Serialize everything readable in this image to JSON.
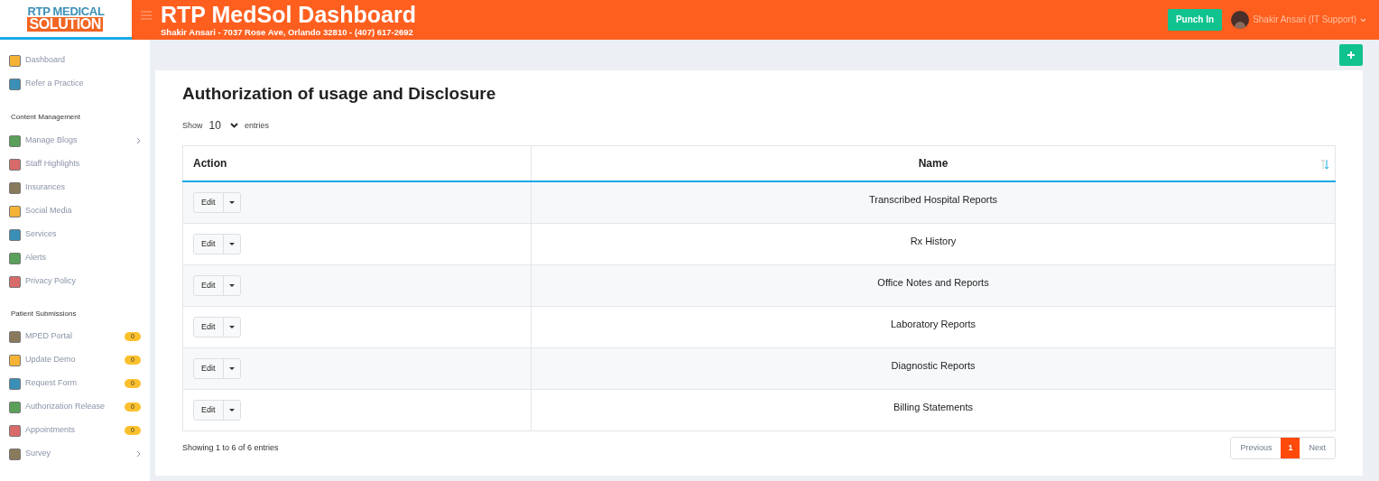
{
  "logo": {
    "line_1": "RTP MEDICAL",
    "line_2": "SOLUTION"
  },
  "header": {
    "title": "RTP MedSol Dashboard",
    "subtitle": "Shakir Ansari - 7037 Rose Ave, Orlando 32810 - (407) 617-2692",
    "punch_button": "Punch In",
    "user": "Shakir Ansari (IT Support)"
  },
  "sidebar": {
    "sections": [
      {
        "items": [
          {
            "label": "Dashboard",
            "expandable": false
          },
          {
            "label": "Refer a Practice",
            "expandable": false
          }
        ]
      },
      {
        "heading": "Content Management",
        "items": [
          {
            "label": "Manage Blogs",
            "expandable": true
          },
          {
            "label": "Staff Highlights",
            "expandable": false
          },
          {
            "label": "Insurances",
            "expandable": false
          },
          {
            "label": "Social Media",
            "expandable": false
          },
          {
            "label": "Services",
            "expandable": false
          },
          {
            "label": "Alerts",
            "expandable": false
          },
          {
            "label": "Privacy Policy",
            "expandable": false
          }
        ]
      },
      {
        "heading": "Patient Submissions",
        "items": [
          {
            "label": "MPED Portal",
            "badge": "0",
            "expandable": false
          },
          {
            "label": "Update Demo",
            "badge": "0",
            "expandable": false
          },
          {
            "label": "Request Form",
            "badge": "0",
            "expandable": false
          },
          {
            "label": "Authorization Release",
            "badge": "0",
            "expandable": false
          },
          {
            "label": "Appointments",
            "badge": "0",
            "expandable": false
          },
          {
            "label": "Survey",
            "expandable": true
          }
        ]
      }
    ]
  },
  "page": {
    "title": "Authorization of usage and Disclosure",
    "show_label": "Show",
    "page_size": "10",
    "entries_label": "entries"
  },
  "table": {
    "columns": [
      "Action",
      "Name"
    ],
    "rows": [
      {
        "action": "Edit",
        "name": "Transcribed Hospital Reports"
      },
      {
        "action": "Edit",
        "name": "Rx History"
      },
      {
        "action": "Edit",
        "name": "Office Notes and Reports"
      },
      {
        "action": "Edit",
        "name": "Laboratory Reports"
      },
      {
        "action": "Edit",
        "name": "Diagnostic Reports"
      },
      {
        "action": "Edit",
        "name": "Billing Statements"
      }
    ]
  },
  "footer": {
    "info": "Showing 1 to 6 of 6 entries",
    "pagination": [
      {
        "label": "Previous",
        "selected": false
      },
      {
        "label": "1",
        "selected": true
      },
      {
        "label": "Next",
        "selected": false
      }
    ]
  }
}
